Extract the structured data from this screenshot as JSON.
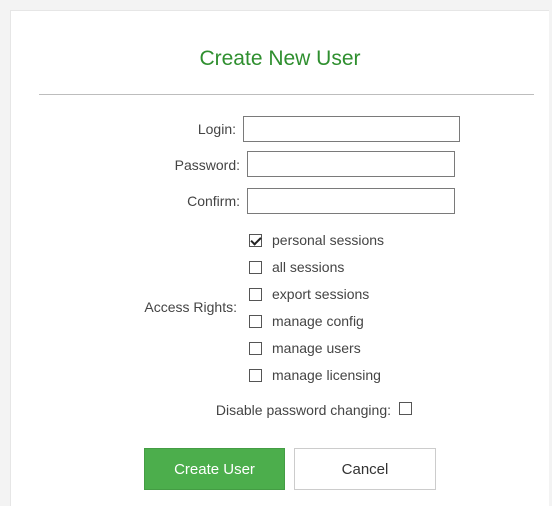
{
  "dialog": {
    "title": "Create New User",
    "fields": {
      "login_label": "Login:",
      "login_value": "",
      "password_label": "Password:",
      "password_value": "",
      "confirm_label": "Confirm:",
      "confirm_value": ""
    },
    "access_rights_label": "Access Rights:",
    "access_rights": [
      {
        "label": "personal sessions",
        "checked": true
      },
      {
        "label": "all sessions",
        "checked": false
      },
      {
        "label": "export sessions",
        "checked": false
      },
      {
        "label": "manage config",
        "checked": false
      },
      {
        "label": "manage users",
        "checked": false
      },
      {
        "label": "manage licensing",
        "checked": false
      }
    ],
    "disable_password_label": "Disable password changing:",
    "disable_password_checked": false,
    "buttons": {
      "create_label": "Create User",
      "cancel_label": "Cancel"
    },
    "colors": {
      "title": "#2f8f2f",
      "primary_button": "#4cae4c"
    }
  }
}
